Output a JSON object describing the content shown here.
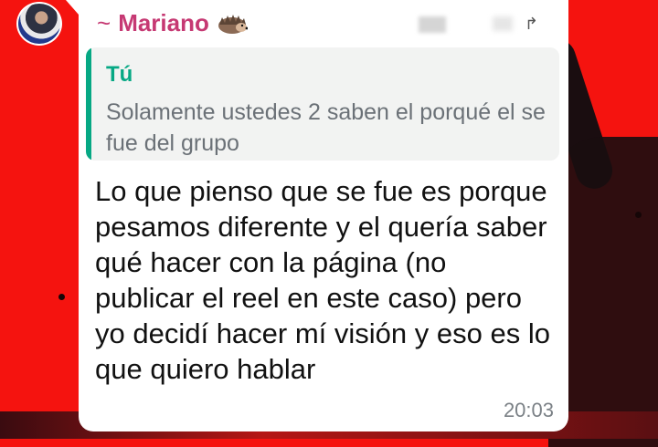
{
  "chat": {
    "sender_name": "Mariano",
    "sender_prefix": "~",
    "sender_badge_icon": "hedgehog-icon",
    "reply": {
      "author": "Tú",
      "text": "Solamente ustedes 2 saben el porqué el se fue del grupo"
    },
    "message_text": "Lo que pienso que se fue es porque pesamos diferente y el quería saber qué hacer con la página (no publicar el reel en este caso) pero yo decidí hacer mí visión y eso es lo que quiero hablar",
    "time": "20:03"
  },
  "colors": {
    "background": "#f5130f",
    "sender": "#c63973",
    "reply_accent": "#06a884"
  }
}
